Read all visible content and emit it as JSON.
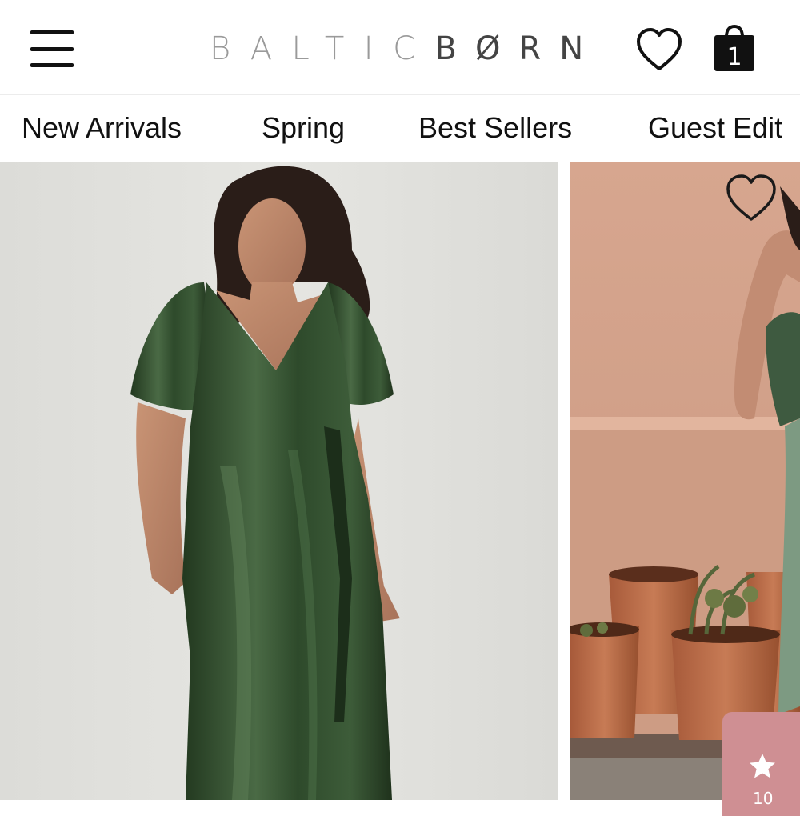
{
  "header": {
    "logo_part1": "BALTIC",
    "logo_part2": "BØRN",
    "icons": {
      "menu": "hamburger-menu-icon",
      "wishlist": "heart-outline-icon",
      "cart": "shopping-bag-icon"
    },
    "cart_count": "1"
  },
  "category_nav": {
    "tabs": [
      {
        "label": "New Arrivals"
      },
      {
        "label": "Spring"
      },
      {
        "label": "Best Sellers"
      },
      {
        "label": "Guest Edit"
      }
    ]
  },
  "products": [
    {
      "image": "woman-in-green-velvet-wrap-maxi-dress"
    },
    {
      "image": "woman-in-sage-dress-by-terracotta-pots",
      "wishlist_icon": "heart-outline-icon"
    }
  ],
  "reviews_tab": {
    "icon": "star-icon",
    "count": "10"
  },
  "colors": {
    "accent_reviews": "#cf8f93",
    "dress_green": "#2f4a2f",
    "logo_light": "#9a9a9a",
    "logo_dark": "#444444"
  }
}
